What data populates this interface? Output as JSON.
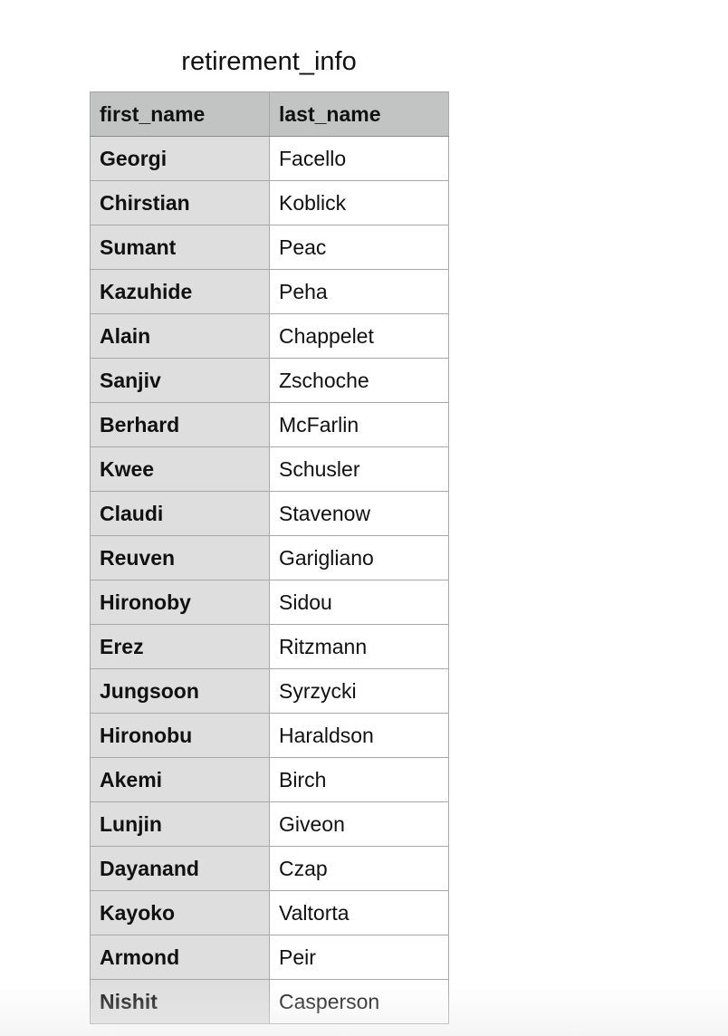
{
  "table": {
    "title": "retirement_info",
    "columns": [
      "first_name",
      "last_name"
    ],
    "rows": [
      {
        "first_name": "Georgi",
        "last_name": "Facello"
      },
      {
        "first_name": "Chirstian",
        "last_name": "Koblick"
      },
      {
        "first_name": "Sumant",
        "last_name": "Peac"
      },
      {
        "first_name": "Kazuhide",
        "last_name": "Peha"
      },
      {
        "first_name": "Alain",
        "last_name": "Chappelet"
      },
      {
        "first_name": "Sanjiv",
        "last_name": "Zschoche"
      },
      {
        "first_name": "Berhard",
        "last_name": "McFarlin"
      },
      {
        "first_name": "Kwee",
        "last_name": "Schusler"
      },
      {
        "first_name": "Claudi",
        "last_name": "Stavenow"
      },
      {
        "first_name": "Reuven",
        "last_name": "Garigliano"
      },
      {
        "first_name": "Hironoby",
        "last_name": "Sidou"
      },
      {
        "first_name": "Erez",
        "last_name": "Ritzmann"
      },
      {
        "first_name": "Jungsoon",
        "last_name": "Syrzycki"
      },
      {
        "first_name": "Hironobu",
        "last_name": "Haraldson"
      },
      {
        "first_name": "Akemi",
        "last_name": "Birch"
      },
      {
        "first_name": "Lunjin",
        "last_name": "Giveon"
      },
      {
        "first_name": "Dayanand",
        "last_name": "Czap"
      },
      {
        "first_name": "Kayoko",
        "last_name": "Valtorta"
      },
      {
        "first_name": "Armond",
        "last_name": "Peir"
      },
      {
        "first_name": "Nishit",
        "last_name": "Casperson"
      }
    ]
  },
  "colors": {
    "header_bg": "#c2c4c3",
    "first_column_bg": "#dedede",
    "cell_bg": "#ffffff",
    "grid_line": "#a8a8a8"
  }
}
